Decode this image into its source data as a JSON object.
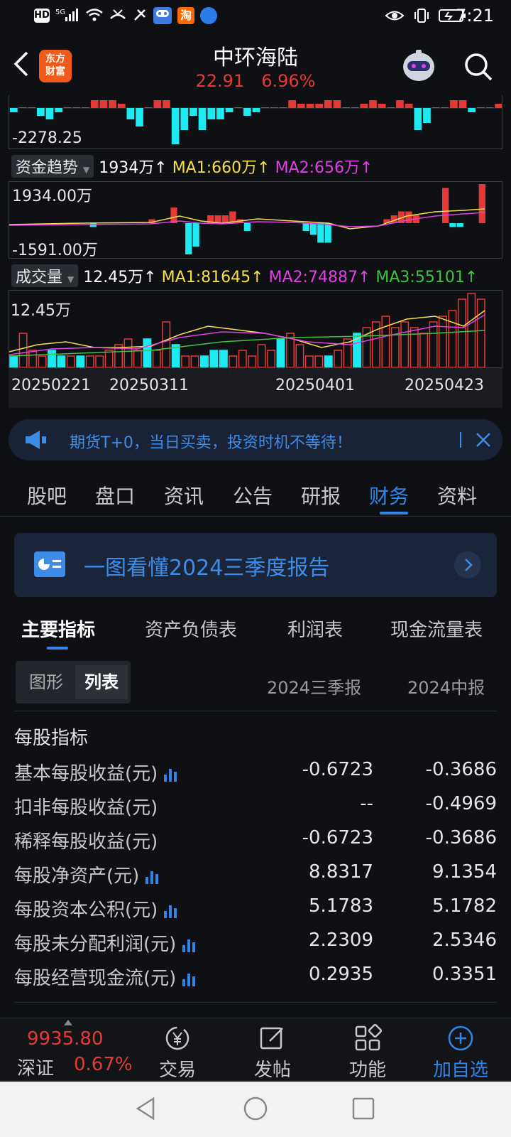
{
  "status_bar": {
    "time": "7:21",
    "left_icons": [
      "HD",
      "5G",
      "signal-icon",
      "wifi-icon",
      "call-missed-icon",
      "bluetooth-icon",
      "game-icon",
      "taobao-icon",
      "browser-icon"
    ],
    "right_icons": [
      "eye-icon",
      "vibrate-icon",
      "battery-icon"
    ]
  },
  "header": {
    "logo_line1": "东方",
    "logo_line2": "财富",
    "title": "中环海陆",
    "price": "22.91",
    "change_pct": "6.96%"
  },
  "top_chart": {
    "min_label": "-2278.25"
  },
  "fund_trend": {
    "label": "资金趋势",
    "value": "1934万↑",
    "ma1": "MA1:660万↑",
    "ma2": "MA2:656万↑",
    "max_label": "1934.00万",
    "min_label": "-1591.00万"
  },
  "volume": {
    "label": "成交量",
    "value": "12.45万↑",
    "ma1": "MA1:81645↑",
    "ma2": "MA2:74887↑",
    "ma3": "MA3:55101↑",
    "max_label": "12.45万",
    "dates": [
      "20250221",
      "20250311",
      "20250401",
      "20250423"
    ]
  },
  "banner": {
    "text": "期货T+0，当日买卖，投资时机不等待！"
  },
  "tabs": [
    "股吧",
    "盘口",
    "资讯",
    "公告",
    "研报",
    "财务",
    "资料"
  ],
  "active_tab": "财务",
  "report_card": {
    "text": "一图看懂2024三季度报告"
  },
  "sub_tabs": [
    "主要指标",
    "资产负债表",
    "利润表",
    "现金流量表"
  ],
  "view_toggle": {
    "chart": "图形",
    "list": "列表"
  },
  "columns": [
    "2024三季报",
    "2024中报"
  ],
  "section_title": "每股指标",
  "rows": [
    {
      "name": "基本每股收益(元)",
      "v1": "-0.6723",
      "v2": "-0.3686",
      "chart": true
    },
    {
      "name": "扣非每股收益(元)",
      "v1": "--",
      "v2": "-0.4969",
      "chart": false
    },
    {
      "name": "稀释每股收益(元)",
      "v1": "-0.6723",
      "v2": "-0.3686",
      "chart": false
    },
    {
      "name": "每股净资产(元)",
      "v1": "8.8317",
      "v2": "9.1354",
      "chart": true
    },
    {
      "name": "每股资本公积(元)",
      "v1": "5.1783",
      "v2": "5.1782",
      "chart": true
    },
    {
      "name": "每股未分配利润(元)",
      "v1": "2.2309",
      "v2": "2.5346",
      "chart": true
    },
    {
      "name": "每股经营现金流(元)",
      "v1": "0.2935",
      "v2": "0.3351",
      "chart": true
    }
  ],
  "bottom_bar": {
    "index_value": "9935.80",
    "index_name": "深证",
    "index_change": "0.67%",
    "trade": "交易",
    "post": "发帖",
    "features": "功能",
    "add_watch": "加自选"
  },
  "colors": {
    "up": "#e53935",
    "down": "#1de9f0",
    "accent": "#2f86e8",
    "ma1": "#f5e04a",
    "ma2": "#e23fe6",
    "ma3": "#3ec43e"
  }
}
